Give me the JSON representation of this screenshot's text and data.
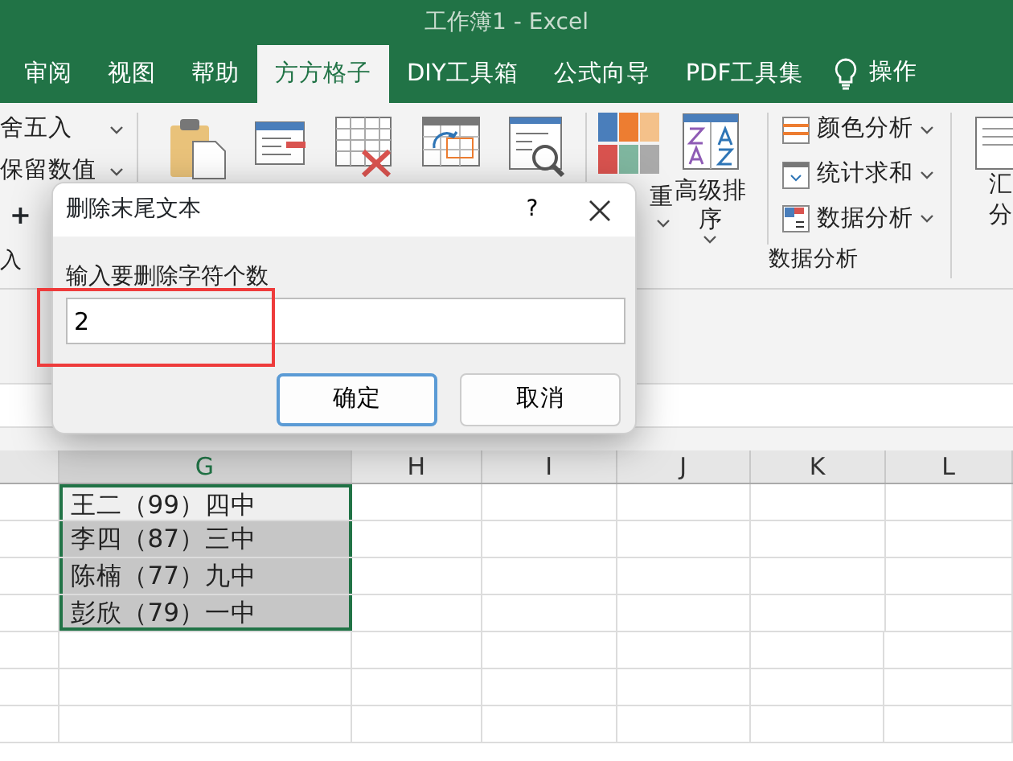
{
  "window": {
    "title": "工作簿1  -  Excel"
  },
  "tabs": [
    {
      "label": "审阅",
      "selected": false
    },
    {
      "label": "视图",
      "selected": false
    },
    {
      "label": "帮助",
      "selected": false
    },
    {
      "label": "方方格子",
      "selected": true
    },
    {
      "label": "DIY工具箱",
      "selected": false
    },
    {
      "label": "公式向导",
      "selected": false
    },
    {
      "label": "PDF工具集",
      "selected": false
    }
  ],
  "tell_me": {
    "label": "操作"
  },
  "ribbon": {
    "left_items": [
      {
        "label": "舍五入"
      },
      {
        "label": "保留数值"
      }
    ],
    "add_button": "+",
    "left_group_label": "入",
    "data_buttons": [
      {
        "kind": "random",
        "label": "重"
      },
      {
        "kind": "sort",
        "label": "高级排序"
      }
    ],
    "data_menu": [
      {
        "kind": "color",
        "label": "颜色分析"
      },
      {
        "kind": "sum",
        "label": "统计求和"
      },
      {
        "kind": "data",
        "label": "数据分析"
      }
    ],
    "data_group_label": "数据分析",
    "right_lines": [
      "汇",
      "分"
    ]
  },
  "dialog": {
    "title": "删除末尾文本",
    "help": "?",
    "label": "输入要删除字符个数",
    "value": "2",
    "buttons": [
      {
        "label": "确定",
        "default": true
      },
      {
        "label": "取消",
        "default": false
      }
    ]
  },
  "sheet": {
    "columns": [
      "G",
      "H",
      "I",
      "J",
      "K",
      "L"
    ],
    "cells": [
      {
        "text": "王二（99）四中",
        "active": true
      },
      {
        "text": "李四（87）三中",
        "active": false
      },
      {
        "text": "陈楠（77）九中",
        "active": false
      },
      {
        "text": "彭欣（79）一中",
        "active": false
      }
    ]
  }
}
